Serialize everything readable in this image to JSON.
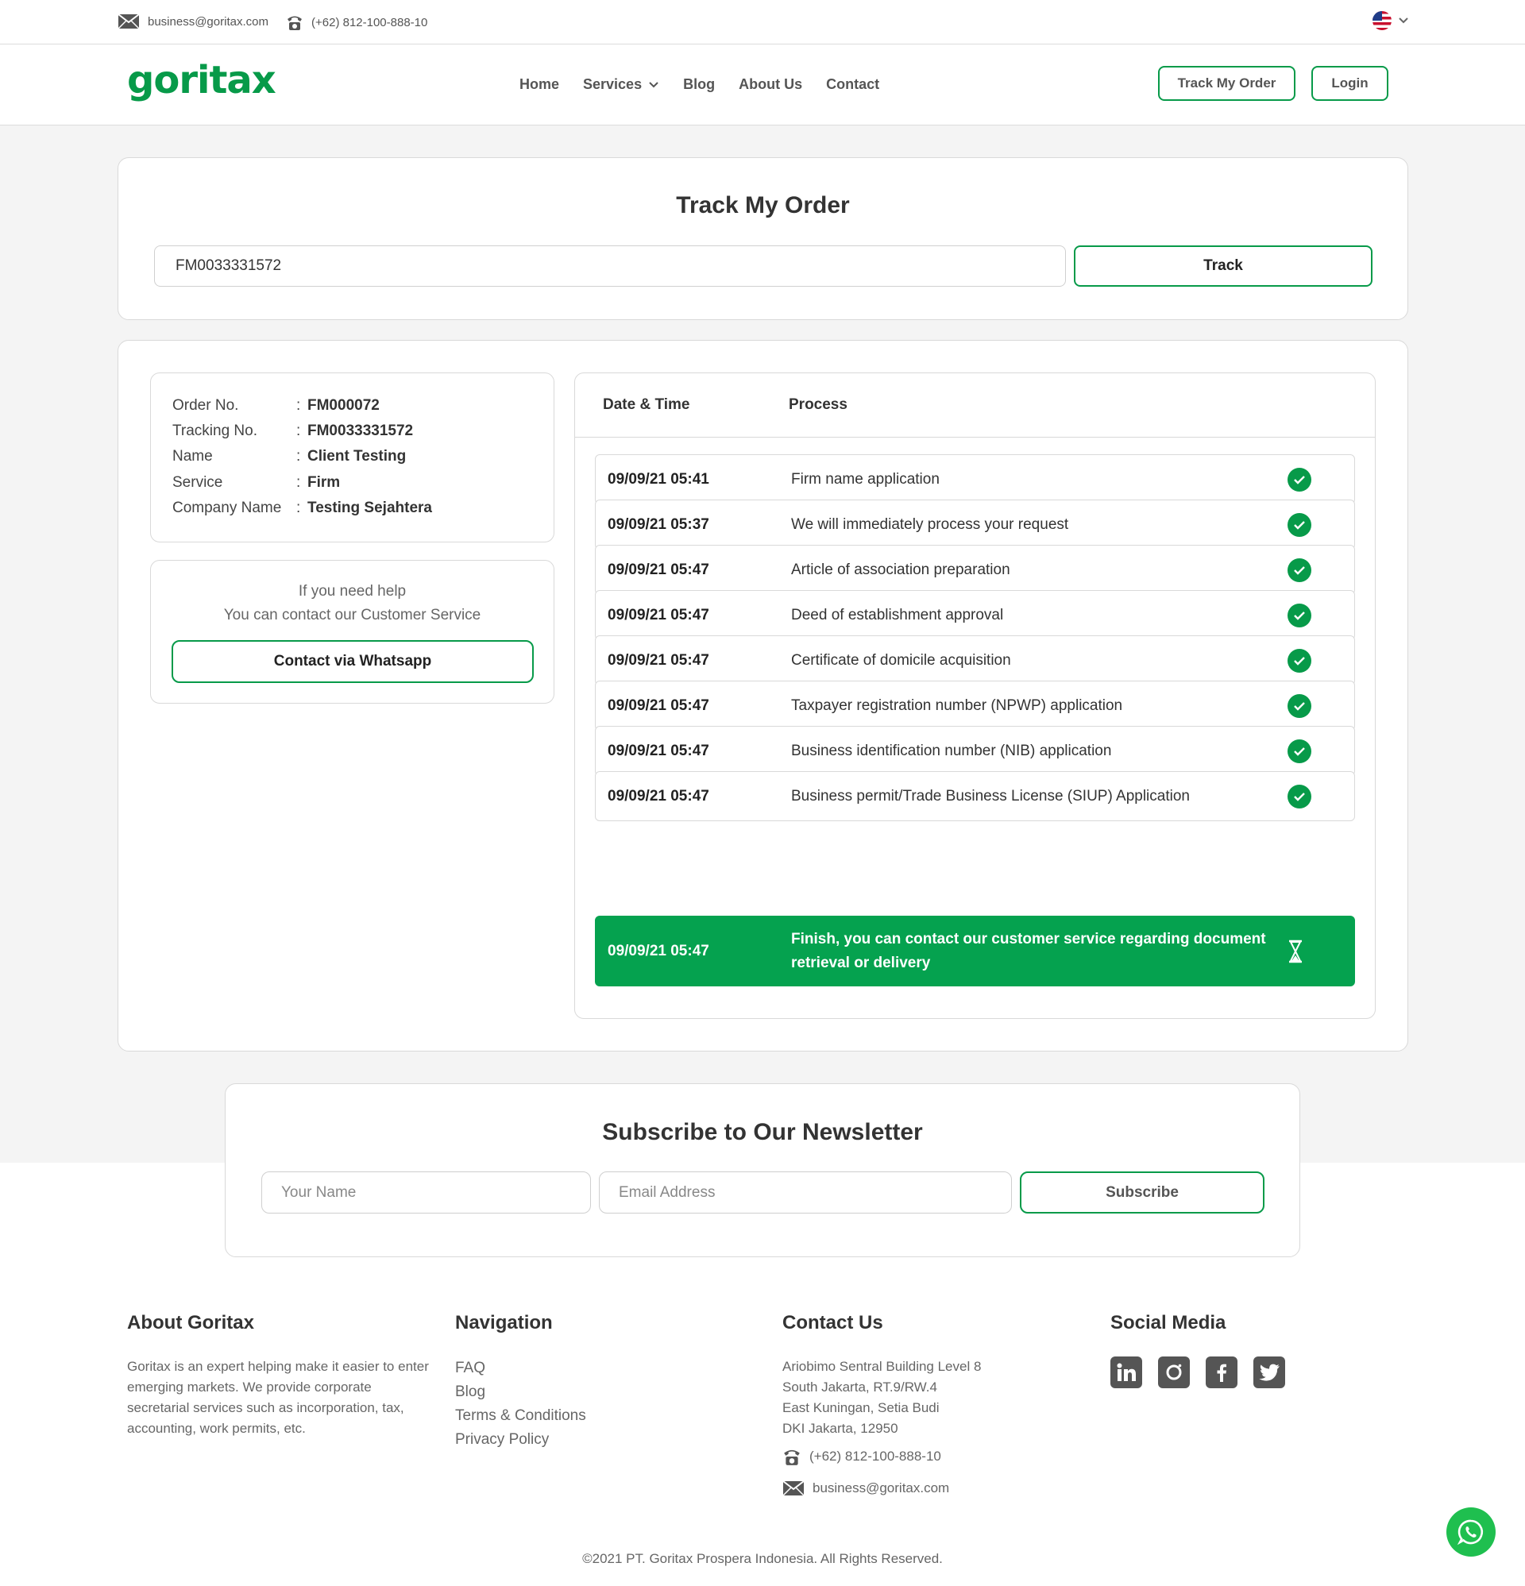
{
  "topbar": {
    "email": "business@goritax.com",
    "phone": "(+62) 812-100-888-10"
  },
  "nav": {
    "logo": "goritax",
    "links": [
      "Home",
      "Services",
      "Blog",
      "About Us",
      "Contact"
    ],
    "track_button": "Track My Order",
    "login_button": "Login"
  },
  "track": {
    "title": "Track My Order",
    "input_value": "FM0033331572",
    "button": "Track"
  },
  "order": {
    "rows": [
      {
        "label": "Order No.",
        "value": "FM000072"
      },
      {
        "label": "Tracking No.",
        "value": "FM0033331572"
      },
      {
        "label": "Name",
        "value": "Client Testing"
      },
      {
        "label": "Service",
        "value": "Firm"
      },
      {
        "label": "Company Name",
        "value": "Testing Sejahtera"
      }
    ],
    "separator": ":"
  },
  "help": {
    "line1": "If you need help",
    "line2": "You can contact our Customer Service",
    "button": "Contact via Whatsapp"
  },
  "process": {
    "header_datetime": "Date & Time",
    "header_process": "Process",
    "steps": [
      {
        "datetime": "09/09/21 05:41",
        "process": "Firm name application",
        "status": "done"
      },
      {
        "datetime": "09/09/21 05:37",
        "process": "We will immediately process your request",
        "status": "done"
      },
      {
        "datetime": "09/09/21 05:47",
        "process": "Article of association preparation",
        "status": "done"
      },
      {
        "datetime": "09/09/21 05:47",
        "process": "Deed of establishment approval",
        "status": "done"
      },
      {
        "datetime": "09/09/21 05:47",
        "process": "Certificate of domicile acquisition",
        "status": "done"
      },
      {
        "datetime": "09/09/21 05:47",
        "process": "Taxpayer registration number (NPWP) application",
        "status": "done"
      },
      {
        "datetime": "09/09/21 05:47",
        "process": "Business identification number (NIB) application",
        "status": "done"
      },
      {
        "datetime": "09/09/21 05:47",
        "process": "Business permit/Trade Business License (SIUP) Application",
        "status": "done"
      }
    ],
    "final": {
      "datetime": "09/09/21 05:47",
      "process": "Finish, you can contact our customer service regarding document retrieval or delivery",
      "status": "pending"
    }
  },
  "newsletter": {
    "title": "Subscribe to Our Newsletter",
    "name_placeholder": "Your Name",
    "email_placeholder": "Email Address",
    "button": "Subscribe"
  },
  "footer": {
    "about_title": "About Goritax",
    "about_text": "Goritax is an expert helping make it easier to enter emerging markets. We provide corporate secretarial services such as incorporation, tax, accounting, work permits, etc.",
    "nav_title": "Navigation",
    "nav_links": [
      "FAQ",
      "Blog",
      "Terms & Conditions",
      "Privacy Policy"
    ],
    "contact_title": "Contact Us",
    "address": [
      "Ariobimo Sentral Building Level 8",
      "South Jakarta, RT.9/RW.4",
      "East Kuningan, Setia Budi",
      "DKI Jakarta, 12950"
    ],
    "phone": "(+62) 812-100-888-10",
    "email": "business@goritax.com",
    "social_title": "Social Media",
    "social": [
      "linkedin-icon",
      "instagram-icon",
      "facebook-icon",
      "twitter-icon"
    ],
    "copyright": "©2021 PT. Goritax Prospera Indonesia. All Rights Reserved."
  },
  "colors": {
    "brand_green": "#079a49",
    "final_row_green": "#05a24f"
  }
}
